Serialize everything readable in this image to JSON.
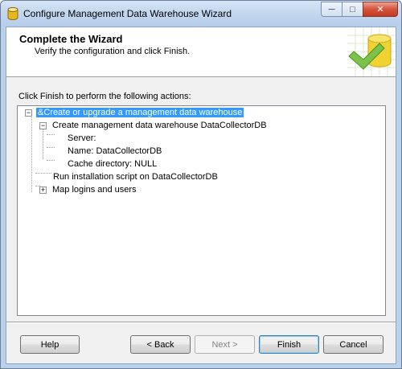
{
  "window": {
    "title": "Configure Management Data Warehouse Wizard",
    "controls": {
      "minimize": "─",
      "maximize": "□",
      "close": "✕"
    }
  },
  "header": {
    "title": "Complete the Wizard",
    "subtitle": "Verify the configuration and click Finish."
  },
  "body": {
    "instructions": "Click Finish to perform the following actions:"
  },
  "tree": {
    "root": {
      "label": "&Create or upgrade a management data warehouse",
      "expanded": true,
      "selected": true
    },
    "create": {
      "label": "Create management data warehouse DataCollectorDB",
      "expanded": true
    },
    "server": {
      "label": "Server: "
    },
    "name": {
      "label": "Name: DataCollectorDB"
    },
    "cache": {
      "label": "Cache directory: NULL"
    },
    "script": {
      "label": "Run installation script on DataCollectorDB"
    },
    "logins": {
      "label": "Map logins and users",
      "expanded": false
    }
  },
  "buttons": {
    "help": "Help",
    "back": "< Back",
    "next": "Next >",
    "finish": "Finish",
    "cancel": "Cancel"
  },
  "colors": {
    "selection": "#3399ff",
    "title_bar": "#c2d6ee",
    "close_button": "#c23a22"
  }
}
